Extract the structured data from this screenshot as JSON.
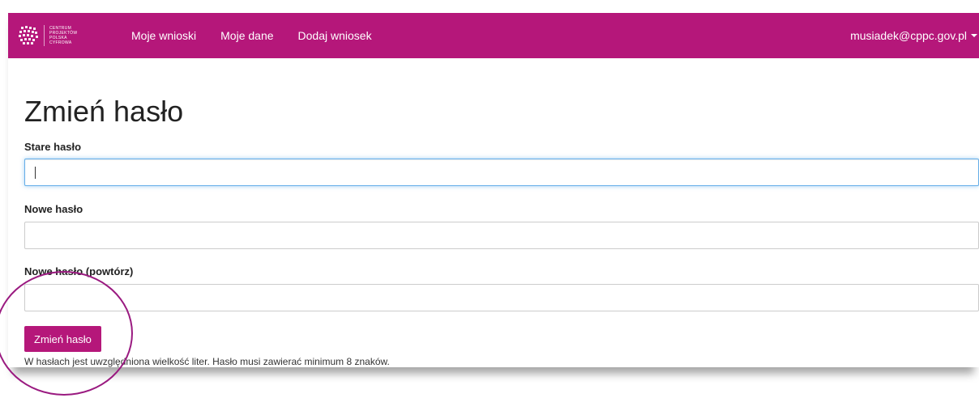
{
  "brand": {
    "logo_lines": [
      "CENTRUM",
      "PROJEKTÓW",
      "POLSKA",
      "CYFROWA"
    ],
    "accent_color": "#b5177a"
  },
  "nav": {
    "links": [
      "Moje wnioski",
      "Moje dane",
      "Dodaj wniosek"
    ],
    "user_email": "musiadek@cppc.gov.pl"
  },
  "page": {
    "title": "Zmień hasło"
  },
  "form": {
    "old_password": {
      "label": "Stare hasło",
      "value": ""
    },
    "new_password": {
      "label": "Nowe hasło",
      "value": ""
    },
    "repeat_password": {
      "label": "Nowe hasło (powtórz)",
      "value": ""
    },
    "submit_label": "Zmień hasło",
    "help_text": "W hasłach jest uwzględniona wielkość liter. Hasło musi zawierać minimum 8 znaków."
  },
  "icons": {
    "logo": "cppc-logo-icon",
    "dropdown": "caret-down-icon"
  }
}
